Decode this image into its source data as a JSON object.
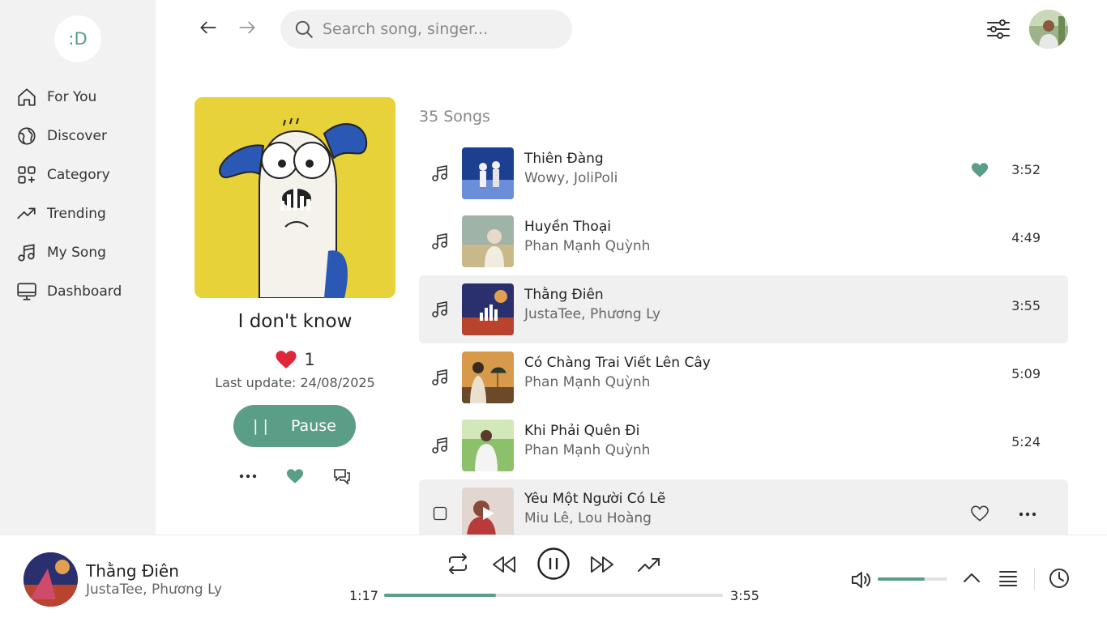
{
  "app": {
    "logo": ":D",
    "accent": "#5a9e87"
  },
  "sidebar": {
    "items": [
      {
        "label": "For You",
        "icon": "home-icon"
      },
      {
        "label": "Discover",
        "icon": "globe-icon"
      },
      {
        "label": "Category",
        "icon": "category-grid-icon"
      },
      {
        "label": "Trending",
        "icon": "trending-icon"
      },
      {
        "label": "My Song",
        "icon": "music-note-icon"
      },
      {
        "label": "Dashboard",
        "icon": "monitor-icon"
      }
    ]
  },
  "header": {
    "search_placeholder": "Search song, singer..."
  },
  "album": {
    "title": "I don't know",
    "likes": "1",
    "last_update": "Last update: 24/08/2025",
    "pause_label": "Pause",
    "pause_bars": "||"
  },
  "songs": {
    "count_label": "35 Songs",
    "items": [
      {
        "title": "Thiên Đàng",
        "artist": "Wowy, JoliPoli",
        "duration": "3:52",
        "liked": true
      },
      {
        "title": "Huyền Thoại",
        "artist": "Phan Mạnh Quỳnh",
        "duration": "4:49"
      },
      {
        "title": "Thằng Điên",
        "artist": "JustaTee, Phương Ly",
        "duration": "3:55",
        "active": true
      },
      {
        "title": "Có Chàng Trai Viết Lên Cây",
        "artist": "Phan Mạnh Quỳnh",
        "duration": "5:09"
      },
      {
        "title": "Khi Phải Quên Đi",
        "artist": "Phan Mạnh Quỳnh",
        "duration": "5:24"
      },
      {
        "title": "Yêu Một Người Có Lẽ",
        "artist": "Miu Lê, Lou Hoàng",
        "duration": ""
      }
    ]
  },
  "player": {
    "title": "Thằng Điên",
    "artist": "JustaTee, Phương Ly",
    "current_time": "1:17",
    "total_time": "3:55",
    "progress_fraction": 0.33,
    "volume_fraction": 0.67
  }
}
